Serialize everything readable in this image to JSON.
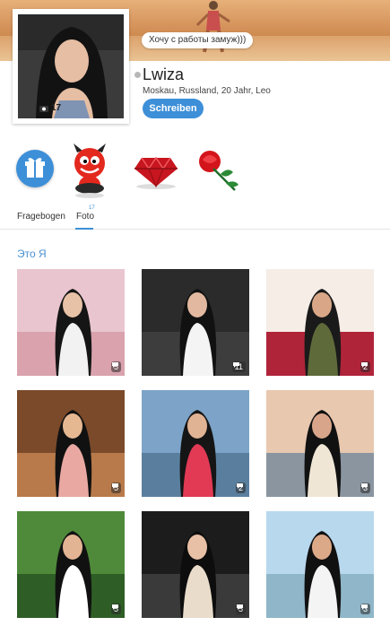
{
  "profile": {
    "status": "Хочу с работы замуж)))",
    "name": "Lwiza",
    "meta": "Moskau, Russland, 20 Jahr, Leo",
    "photo_count": "17",
    "write_label": "Schreiben"
  },
  "gifts": [
    {
      "name": "gift-box-icon"
    },
    {
      "name": "devil-sticker-icon"
    },
    {
      "name": "ruby-gem-icon"
    },
    {
      "name": "red-rose-icon"
    }
  ],
  "tabs": {
    "questionnaire": "Fragebogen",
    "photos": "Foto",
    "photos_badge": "17"
  },
  "section": {
    "title": "Это Я"
  },
  "photos": [
    {
      "comments": "5",
      "palette": [
        "#e9c6cf",
        "#d9a2ad",
        "#151515",
        "#e8c2a6",
        "#f2f2f2"
      ]
    },
    {
      "comments": "11",
      "palette": [
        "#2b2b2b",
        "#3d3d3d",
        "#111111",
        "#e2b9a0",
        "#f4f4f4"
      ]
    },
    {
      "comments": "2",
      "palette": [
        "#f5ede6",
        "#b0243a",
        "#1a1a1a",
        "#d9a787",
        "#5f6a3a"
      ]
    },
    {
      "comments": "5",
      "palette": [
        "#7a4a2a",
        "#b87a4a",
        "#111111",
        "#e6b892",
        "#e9a9a2"
      ]
    },
    {
      "comments": "2",
      "palette": [
        "#7da4c8",
        "#5a7f9e",
        "#151515",
        "#e0b394",
        "#e23a55"
      ]
    },
    {
      "comments": "3",
      "palette": [
        "#e9c8b0",
        "#8a95a0",
        "#111111",
        "#d9a58a",
        "#f0e6d6"
      ]
    },
    {
      "comments": "5",
      "palette": [
        "#4f8a3a",
        "#2e5e26",
        "#111111",
        "#e3b493",
        "#ffffff"
      ]
    },
    {
      "comments": "5",
      "palette": [
        "#1c1c1c",
        "#3a3a3a",
        "#0d0d0d",
        "#e8c0a6",
        "#e9dccb"
      ]
    },
    {
      "comments": "3",
      "palette": [
        "#b8d8ee",
        "#8fb6c9",
        "#111111",
        "#dca988",
        "#f4f4f4"
      ]
    }
  ]
}
